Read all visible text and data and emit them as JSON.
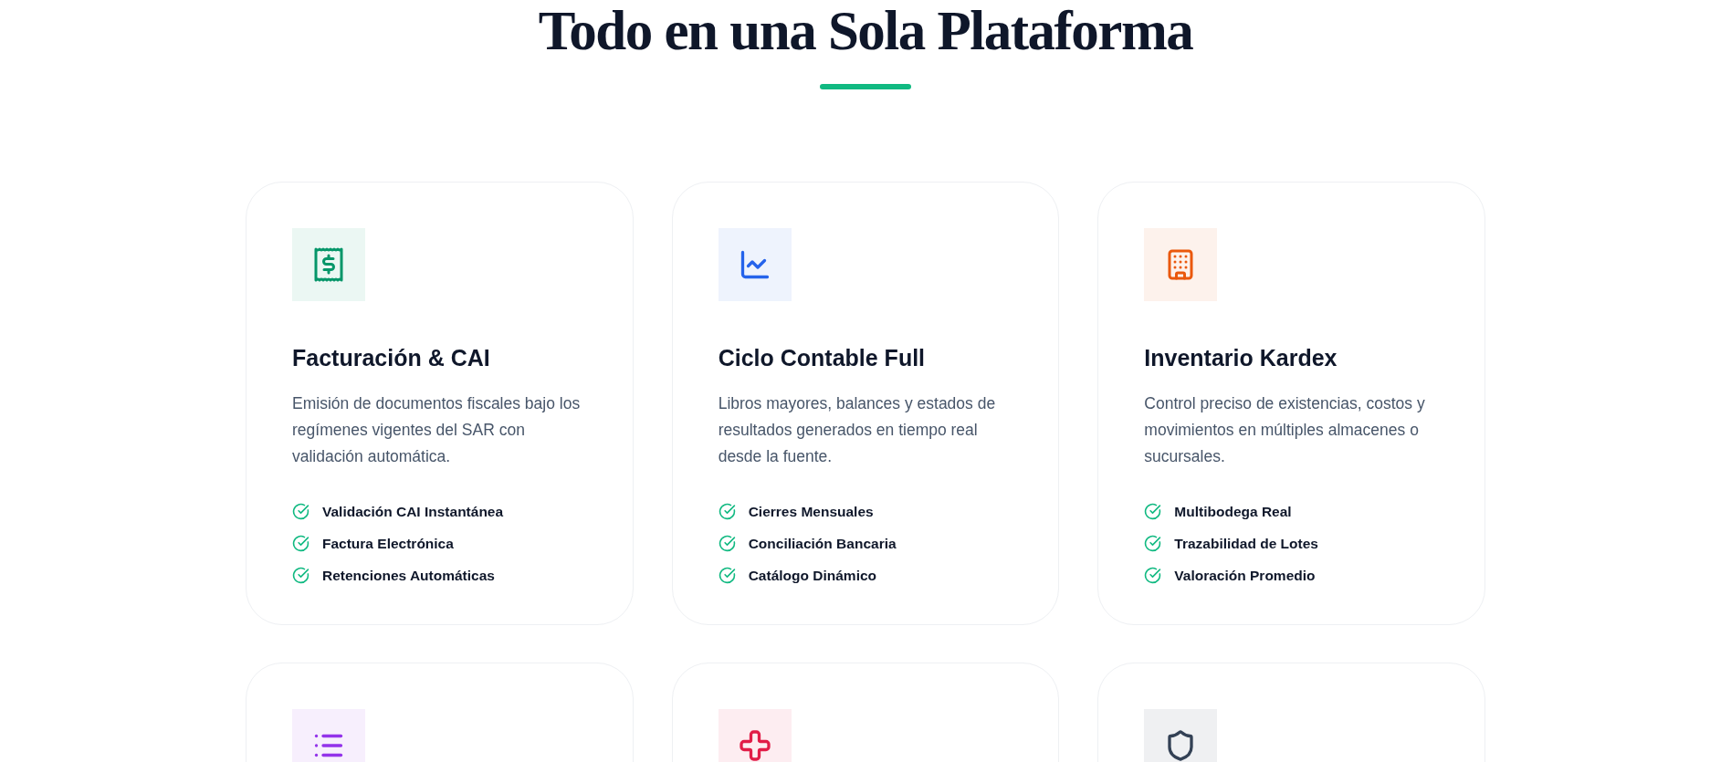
{
  "section": {
    "title": "Todo en una Sola Plataforma"
  },
  "cards": [
    {
      "color": "#059669",
      "title": "Facturación & CAI",
      "description": "Emisión de documentos fiscales bajo los regímenes vigentes del SAR con validación automática.",
      "features": [
        "Validación CAI Instantánea",
        "Factura Electrónica",
        "Retenciones Automáticas"
      ]
    },
    {
      "color": "#2563eb",
      "title": "Ciclo Contable Full",
      "description": "Libros mayores, balances y estados de resultados generados en tiempo real desde la fuente.",
      "features": [
        "Cierres Mensuales",
        "Conciliación Bancaria",
        "Catálogo Dinámico"
      ]
    },
    {
      "color": "#ea580c",
      "title": "Inventario Kardex",
      "description": "Control preciso de existencias, costos y movimientos en múltiples almacenes o sucursales.",
      "features": [
        "Multibodega Real",
        "Trazabilidad de Lotes",
        "Valoración Promedio"
      ]
    },
    {
      "color": "#9333ea"
    },
    {
      "color": "#e11d48"
    },
    {
      "color": "#334155"
    }
  ]
}
